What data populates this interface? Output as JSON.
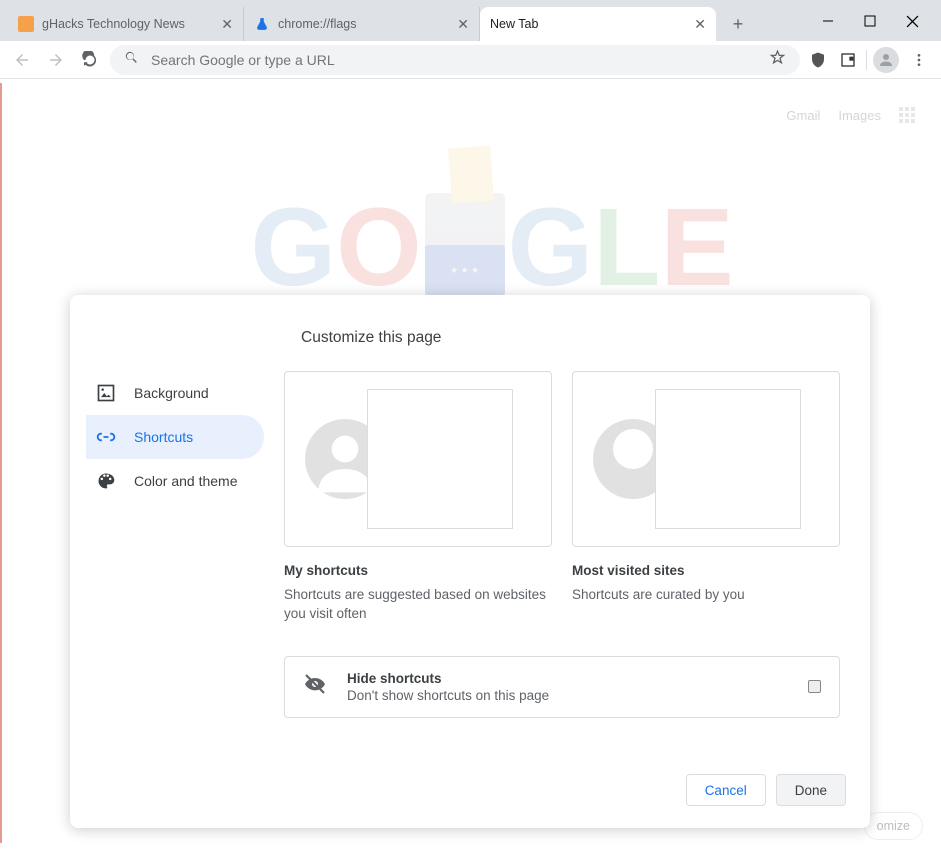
{
  "tabs": [
    {
      "title": "gHacks Technology News"
    },
    {
      "title": "chrome://flags"
    },
    {
      "title": "New Tab"
    }
  ],
  "omnibox": {
    "placeholder": "Search Google or type a URL"
  },
  "header_links": {
    "gmail": "Gmail",
    "images": "Images"
  },
  "modal": {
    "title": "Customize this page",
    "sidebar": {
      "background": "Background",
      "shortcuts": "Shortcuts",
      "color_theme": "Color and theme"
    },
    "options": {
      "my_shortcuts": {
        "title": "My shortcuts",
        "desc": "Shortcuts are suggested based on websites you visit often"
      },
      "most_visited": {
        "title": "Most visited sites",
        "desc": "Shortcuts are curated by you"
      }
    },
    "hide": {
      "title": "Hide shortcuts",
      "desc": "Don't show shortcuts on this page"
    },
    "buttons": {
      "cancel": "Cancel",
      "done": "Done"
    }
  },
  "customize_remnant": "omize"
}
